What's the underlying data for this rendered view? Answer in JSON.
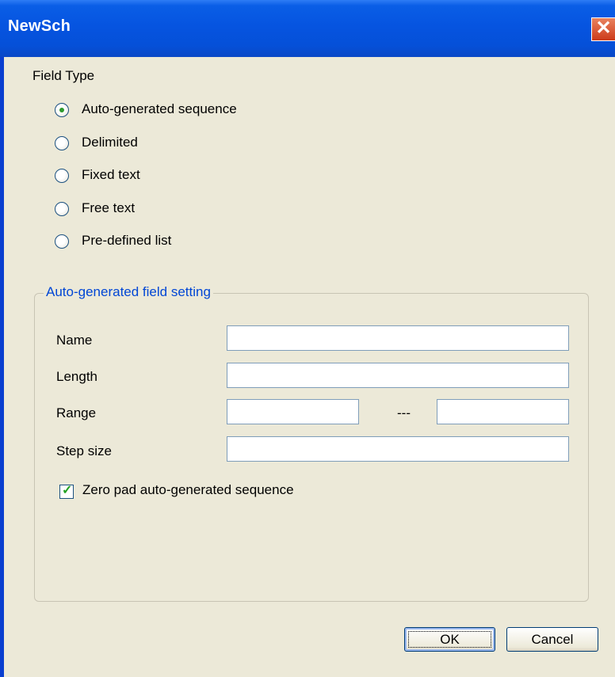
{
  "window": {
    "title": "NewSch",
    "close_symbol": "✕"
  },
  "field_type": {
    "label": "Field Type",
    "options": [
      {
        "label": "Auto-generated sequence",
        "selected": true
      },
      {
        "label": "Delimited",
        "selected": false
      },
      {
        "label": "Fixed text",
        "selected": false
      },
      {
        "label": "Free text",
        "selected": false
      },
      {
        "label": "Pre-defined list",
        "selected": false
      }
    ]
  },
  "settings": {
    "title": "Auto-generated field setting",
    "name_label": "Name",
    "name_value": "",
    "length_label": "Length",
    "length_value": "",
    "range_label": "Range",
    "range_from": "",
    "range_separator": "---",
    "range_to": "",
    "step_label": "Step size",
    "step_value": "",
    "zero_pad_label": "Zero pad auto-generated sequence",
    "zero_pad_checked": true
  },
  "buttons": {
    "ok": "OK",
    "cancel": "Cancel"
  }
}
